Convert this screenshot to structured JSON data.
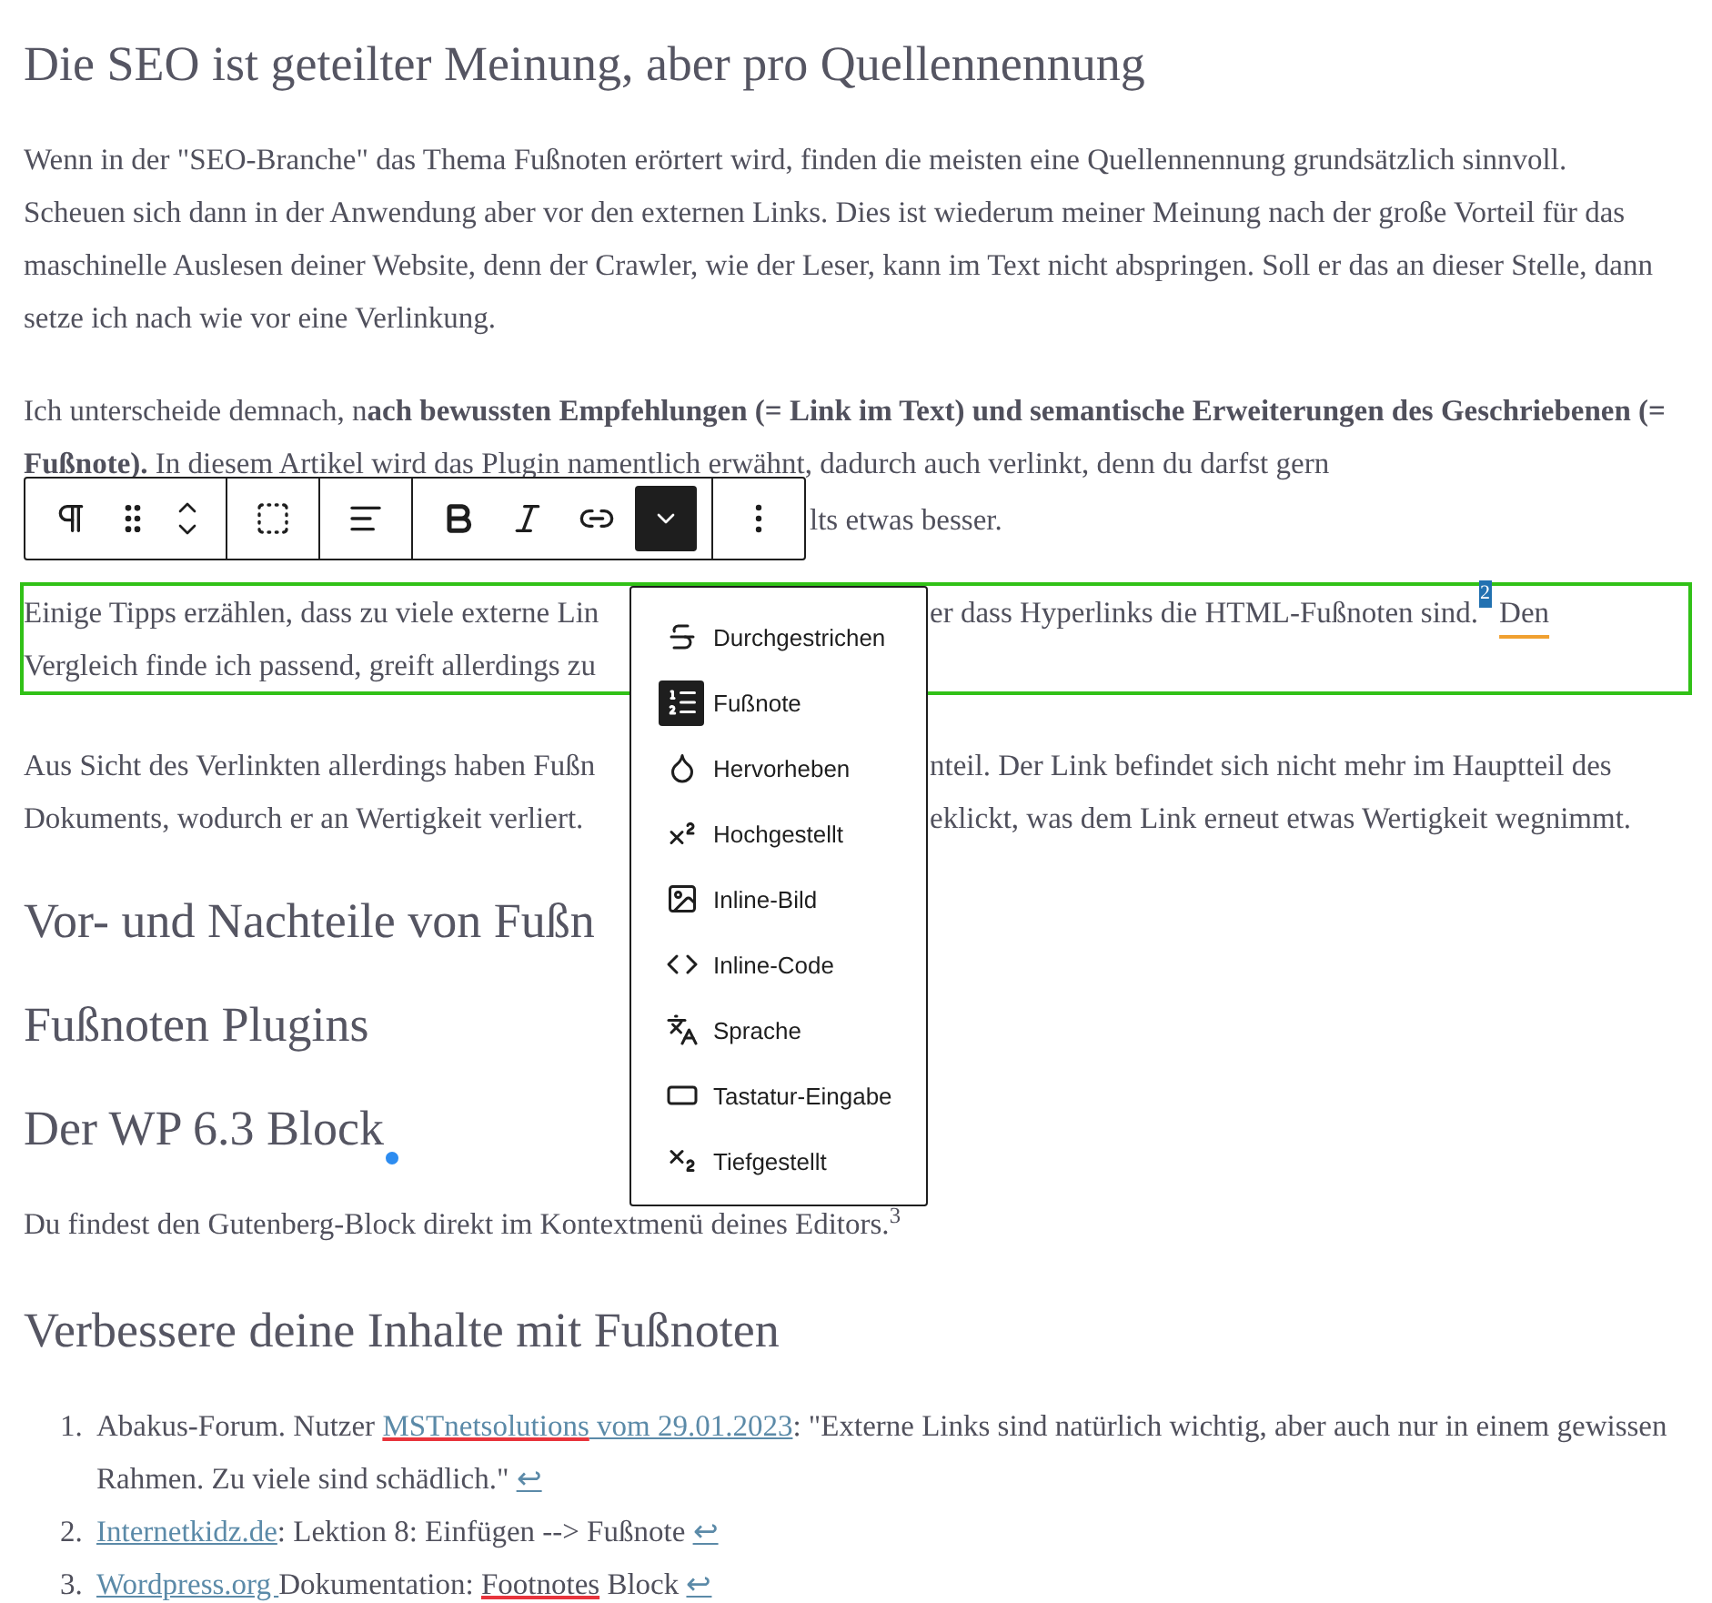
{
  "blocks": [
    {
      "kind": "heading",
      "text": "Die SEO ist geteilter Meinung, aber pro Quellennennung"
    },
    {
      "kind": "paragraph",
      "text": "Wenn in der \"SEO-Branche\" das Thema Fußnoten erörtert wird, finden die meisten eine Quellennennung grundsätzlich sinnvoll. Scheuen sich dann in der Anwendung aber vor den externen Links. Dies ist wiederum meiner Meinung nach der große Vorteil für das maschinelle Auslesen deiner Website, denn der Crawler, wie der Leser, kann im Text nicht abspringen. Soll er das an dieser Stelle, dann setze ich nach wie vor eine Verlinkung."
    },
    {
      "kind": "toolbar_paragraph",
      "text": "Ich unterscheide demnach, n**ach bewussten Empfehlungen (= Link im Text) und semantische Erweiterungen des Geschriebenen (= Fußnote).** In diesem Artikel wird das Plugin namentlich erwähnt, dadurch auch verlinkt, denn du darfst gern",
      "after_toolbar": "lts etwas besser."
    },
    {
      "kind": "split_paragraph",
      "selected": true,
      "lines": [
        {
          "left": "Einige Tipps erzählen, dass zu viele externe Lin",
          "right": "er dass Hyperlinks die HTML-Fußnoten sind.",
          "mark": "2",
          "tail": "Den"
        },
        {
          "left": "Vergleich finde ich passend, greift allerdings zu"
        }
      ]
    },
    {
      "kind": "split_paragraph",
      "selected": false,
      "lines": [
        {
          "left": "Aus Sicht des Verlinkten allerdings haben Fußn",
          "right": "nteil. Der Link befindet sich nicht mehr im Hauptteil des"
        },
        {
          "left": "Dokuments, wodurch er an Wertigkeit verliert.",
          "right": "eklickt, was dem Link erneut etwas Wertigkeit wegnimmt."
        }
      ]
    },
    {
      "kind": "heading",
      "text": "Vor- und Nachteile von Fußn",
      "caret": false
    },
    {
      "kind": "heading",
      "text": "Fußnoten Plugins",
      "caret": false
    },
    {
      "kind": "heading",
      "text": "Der WP 6.3 Block",
      "caret": true
    },
    {
      "kind": "paragraph",
      "text": "Du findest den Gutenberg-Block direkt im Kontextmenü deines Editors.$^{3}$"
    },
    {
      "kind": "heading",
      "text": "Verbessere deine Inhalte mit Fußnoten"
    }
  ],
  "footnotes": [
    {
      "number": "1.",
      "segments": [
        {
          "kind": "text",
          "text": "Abakus-Forum. Nutzer "
        },
        {
          "kind": "misspelled_link",
          "text": "MSTnetsolutions"
        },
        {
          "kind": "link",
          "text": " vom 29.01.2023"
        },
        {
          "kind": "text",
          "text": ": \"Externe Links sind natürlich wichtig, aber auch nur in einem gewissen Rahmen. Zu viele sind schädlich.\" "
        }
      ],
      "backlink": "↩"
    },
    {
      "number": "2.",
      "segments": [
        {
          "kind": "link",
          "text": "Internetkidz.de"
        },
        {
          "kind": "text",
          "text": ": Lektion 8: Einfügen --> Fußnote "
        }
      ],
      "backlink": "↩"
    },
    {
      "number": "3.",
      "segments": [
        {
          "kind": "link",
          "text": "Wordpress.org "
        },
        {
          "kind": "text",
          "text": "Dokumentation: "
        },
        {
          "kind": "misspelled",
          "text": "Footnotes"
        },
        {
          "kind": "text",
          "text": " Block "
        }
      ],
      "backlink": "↩"
    }
  ],
  "toolbar": {
    "groups": [
      {
        "buttons": [
          {
            "kind": "paragraph",
            "selected": false
          },
          {
            "kind": "drag",
            "selected": false
          },
          {
            "kind": "move",
            "selected": false
          }
        ]
      },
      {
        "buttons": [
          {
            "kind": "select_parent",
            "selected": false
          }
        ]
      },
      {
        "buttons": [
          {
            "kind": "align",
            "selected": false
          }
        ]
      },
      {
        "buttons": [
          {
            "kind": "bold",
            "selected": false
          },
          {
            "kind": "italic",
            "selected": false
          },
          {
            "kind": "link",
            "selected": false
          },
          {
            "kind": "more",
            "selected": true
          }
        ]
      },
      {
        "buttons": [
          {
            "kind": "options",
            "selected": false
          }
        ]
      }
    ]
  },
  "format_menu": [
    {
      "label": "Durchgestrichen",
      "kind": "strikethrough",
      "selected": false
    },
    {
      "label": "Fußnote",
      "kind": "footnote",
      "selected": true
    },
    {
      "label": "Hervorheben",
      "kind": "highlight",
      "selected": false
    },
    {
      "label": "Hochgestellt",
      "kind": "superscript",
      "selected": false
    },
    {
      "label": "Inline-Bild",
      "kind": "image",
      "selected": false
    },
    {
      "label": "Inline-Code",
      "kind": "code",
      "selected": false
    },
    {
      "label": "Sprache",
      "kind": "language",
      "selected": false
    },
    {
      "label": "Tastatur-Eingabe",
      "kind": "keyboard",
      "selected": false
    },
    {
      "label": "Tiefgestellt",
      "kind": "subscript",
      "selected": false
    }
  ]
}
